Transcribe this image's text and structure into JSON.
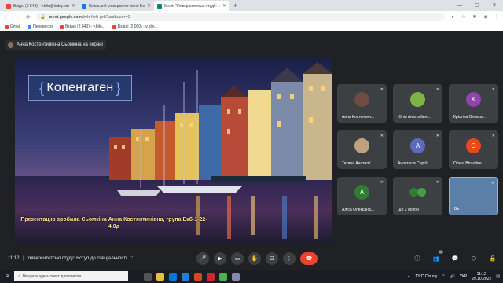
{
  "browser": {
    "tabs": [
      {
        "title": "Вхідні (2 843) - v.bilo@kubg.edu.ua",
        "fav": "#ea4335",
        "active": false
      },
      {
        "title": "Київський університет імені Бориса Грінченка",
        "fav": "#1a73e8",
        "active": false
      },
      {
        "title": "Meet: \"Університетські студії: ...",
        "fav": "#00897b",
        "active": true
      }
    ],
    "new_tab": "+",
    "window": {
      "min": "—",
      "max": "▢",
      "close": "✕"
    },
    "url_domain": "meet.google.com",
    "url_path": "/kvh-fcrh-prh?authuser=0",
    "bookmarks": [
      {
        "label": "Gmail",
        "color": "#ea4335"
      },
      {
        "label": "Перевести",
        "color": "#4285f4"
      },
      {
        "label": "Вхідні (2 843) - v.bilo...",
        "color": "#ea4335"
      },
      {
        "label": "Вхідні (2 000) - v.bilo...",
        "color": "#ea4335"
      }
    ]
  },
  "meet": {
    "presenter_text": "Анна Костентинівна Сьомкіна на екрані",
    "slide": {
      "title": "Копенгаген",
      "caption": "Презентацію зробила Сьомкіна Анна Костянтинівна, група Екб-1-22-4.0д"
    },
    "participants": [
      {
        "name": "Анна Костентин...",
        "initial": "",
        "color": "#6d4c41",
        "photo": true
      },
      {
        "name": "Юлія Анатоліївн...",
        "initial": "",
        "color": "#7cb342",
        "photo": true
      },
      {
        "name": "Крістіна Олекса...",
        "initial": "K",
        "color": "#8e44ad",
        "photo": false
      },
      {
        "name": "Тетяна Анатолії...",
        "initial": "",
        "color": "#c0a080",
        "photo": true
      },
      {
        "name": "Анастасія Сергії...",
        "initial": "A",
        "color": "#5c6bc0",
        "photo": false
      },
      {
        "name": "Ольга Віталіївн...",
        "initial": "O",
        "color": "#e64a19",
        "photo": false
      },
      {
        "name": "Аліса Олександ...",
        "initial": "A",
        "color": "#2e7d32",
        "photo": false
      },
      {
        "name": "Ще 2 особи",
        "initial": "",
        "color": "",
        "photo": false
      },
      {
        "name": "Ви",
        "initial": "",
        "color": "#5b7fa6",
        "photo": true
      }
    ],
    "controls": {
      "time": "11:12",
      "separator": "|",
      "meeting_name": "Університетські студії: Вступ до спеціальності. С...",
      "participants_count": "11"
    }
  },
  "taskbar": {
    "search_placeholder": "Введите здесь текст для поиска",
    "weather": "13°C Cloudy",
    "lang": "УКР",
    "time": "11:12",
    "date": "29.10.2022"
  }
}
